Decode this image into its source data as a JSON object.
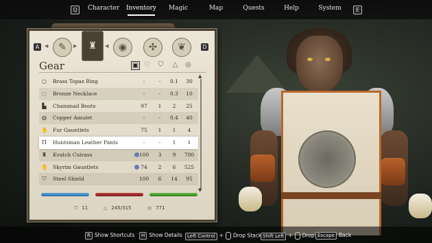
{
  "topbar": {
    "left_key": "Q",
    "right_key": "E",
    "items": [
      "Character",
      "Inventory",
      "Magic",
      "Map",
      "Quests",
      "Help",
      "System"
    ],
    "active": "Inventory"
  },
  "inventory": {
    "tab_keys": [
      "A",
      "D"
    ],
    "category_title": "Gear",
    "column_icons": [
      "value-sort-icon",
      "heart-icon",
      "shield-icon",
      "weight-icon",
      "coin-icon"
    ],
    "items": [
      {
        "icon": "ring-icon",
        "name": "Brass Topaz Ring",
        "c1": "-",
        "c2": "-",
        "c3": "0.1",
        "c4": "30"
      },
      {
        "icon": "necklace-icon",
        "name": "Bronze Necklace",
        "c1": "-",
        "c2": "-",
        "c3": "0.3",
        "c4": "10"
      },
      {
        "icon": "boots-icon",
        "name": "Chainmail Boots",
        "c1": "97",
        "c2": "1",
        "c3": "2",
        "c4": "25"
      },
      {
        "icon": "amulet-icon",
        "name": "Copper Amulet",
        "c1": "-",
        "c2": "-",
        "c3": "0.4",
        "c4": "40"
      },
      {
        "icon": "gauntlets-icon",
        "name": "Fur Gauntlets",
        "c1": "75",
        "c2": "1",
        "c3": "1",
        "c4": "4"
      },
      {
        "icon": "pants-icon",
        "name": "Huntsman Leather Pants",
        "c1": "-",
        "c2": "-",
        "c3": "1",
        "c4": "1"
      },
      {
        "icon": "cuirass-icon",
        "name": "Kvatch Cuirass",
        "c1": "100",
        "c2": "3",
        "c3": "9",
        "c4": "780",
        "badge": true
      },
      {
        "icon": "gauntlets-icon",
        "name": "Skyrim Gauntlets",
        "c1": "74",
        "c2": "2",
        "c3": "6",
        "c4": "525",
        "badge": true
      },
      {
        "icon": "shield-icon",
        "name": "Steel Shield",
        "c1": "100",
        "c2": "6",
        "c3": "14",
        "c4": "95"
      }
    ],
    "stats": {
      "armor": "11",
      "weight": "245/315",
      "gold": "771"
    }
  },
  "bottom_hints": [
    {
      "key": "R",
      "label": "Show Shortcuts"
    },
    {
      "key": "H",
      "label": "Show Details"
    },
    {
      "key": "Left Control",
      "label": "Drop Stack",
      "mouse": true
    },
    {
      "key": "Shift Left",
      "label": "Drop",
      "mouse": true
    },
    {
      "key": "Escape",
      "label": "Back"
    }
  ],
  "colors": {
    "panel_bg": "#e6dfcf",
    "health": "#4a9bd0",
    "magicka": "#b03434",
    "stamina": "#55b03a",
    "tabard_trim": "#b9662b"
  }
}
